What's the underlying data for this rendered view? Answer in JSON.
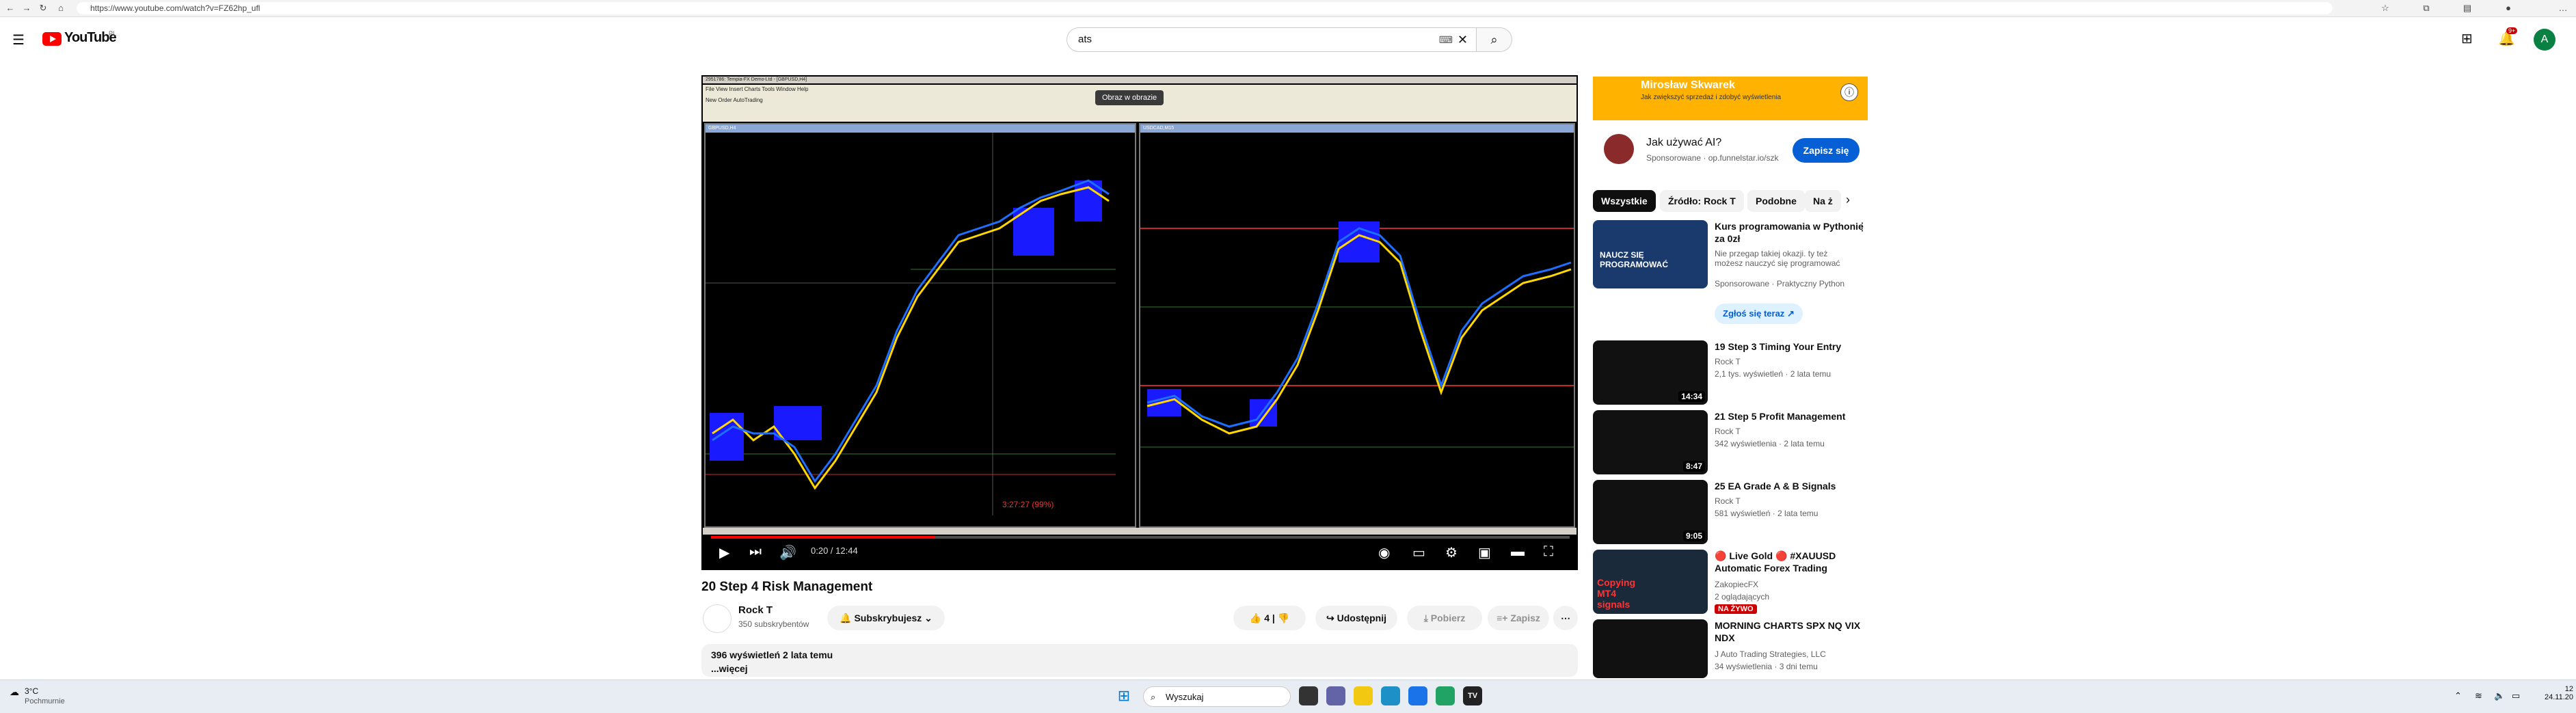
{
  "browser": {
    "url": "https://www.youtube.com/watch?v=FZ62hp_ufl"
  },
  "header": {
    "logo_text": "YouTube",
    "country": "PL",
    "search_value": "ats"
  },
  "video": {
    "overlay_tooltip": "Obraz w obrazie",
    "mt4_title": "2951786: Tempia-FX Demo-Ltd - [GBPUSD,H4]",
    "mt4_menu": "File   View   Insert   Charts   Tools   Window   Help",
    "mt4_toolbar": "New Order     AutoTrading",
    "chart1_header": "GBPUSD,H4",
    "chart2_header": "USDCAD,M15",
    "chart1_countdown": "3:27:27 (99%)",
    "time": "0:20 / 12:44",
    "progress": 0.26,
    "title": "20 Step 4 Risk Management",
    "channel": "Rock T",
    "subscribers": "350 subskrybentów",
    "subscribed_label": "Subskrybujesz",
    "likes": "4",
    "share_label": "Udostępnij",
    "download_label": "Pobierz",
    "save_label": "Zapisz",
    "desc_line1": "396 wyświetleń  2 lata temu",
    "desc_line2": "...więcej"
  },
  "sidebar": {
    "ad_banner_name": "Mirosław Skwarek",
    "ad_banner_sub": "Jak zwiększyć sprzedaż i zdobyć wyświetlenia",
    "ad_title": "Jak używać AI?",
    "ad_sponsor": "Sponsorowane · op.funnelstar.io/szk",
    "ad_button": "Zapisz się",
    "chips": [
      "Wszystkie",
      "Źródło: Rock T",
      "Podobne",
      "Na ż"
    ],
    "items": [
      {
        "title": "Kurs programowania w Pythonie za 0zł",
        "meta1": "Nie przegap takiej okazji. ty też możesz nauczyć się programować",
        "meta2": "Sponsorowane · Praktyczny Python",
        "extra": "Zgłoś się teraz",
        "duration": ""
      },
      {
        "title": "19 Step 3 Timing Your Entry",
        "meta1": "Rock T",
        "meta2": "2,1 tys. wyświetleń  · 2 lata temu",
        "duration": "14:34"
      },
      {
        "title": "21 Step 5 Profit Management",
        "meta1": "Rock T",
        "meta2": "342 wyświetlenia  · 2 lata temu",
        "duration": "8:47"
      },
      {
        "title": "25 EA Grade A & B Signals",
        "meta1": "Rock T",
        "meta2": "581 wyświetleń  · 2 lata temu",
        "duration": "9:05"
      },
      {
        "title": "🔴 Live Gold 🔴 #XAUUSD Automatic Forex Trading",
        "meta1": "ZakopiecFX",
        "meta2": "2 oglądających",
        "badge": "NA ŻYWO",
        "duration": ""
      },
      {
        "title": "MORNING CHARTS SPX NQ VIX NDX",
        "meta1": "J Auto Trading Strategies, LLC",
        "meta2": "34 wyświetlenia  · 3 dni temu",
        "duration": ""
      }
    ]
  },
  "taskbar": {
    "weather_temp": "3°C",
    "weather_state": "Pochmurnie",
    "search_placeholder": "Wyszukaj",
    "time": "12",
    "date": "24.11.20"
  },
  "colors": {
    "youtube_red": "#ff0000",
    "accent_blue": "#065fd4",
    "chart_bull": "#1e6fff",
    "chart_bear": "#ffd700"
  }
}
